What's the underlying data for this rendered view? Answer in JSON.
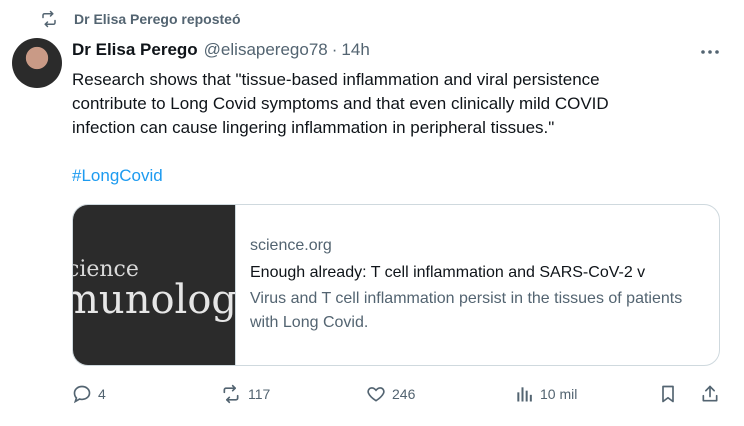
{
  "repost": {
    "label": "Dr Elisa Perego reposteó",
    "icon": "repost-icon"
  },
  "tweet": {
    "author_name": "Dr Elisa Perego",
    "handle": "@elisaperego78",
    "separator": "·",
    "time": "14h",
    "more_icon": "more-icon",
    "text_line1": "Research shows that \"tissue-based inflammation and viral persistence",
    "text_line2": "contribute to Long Covid symptoms and that even clinically mild COVID",
    "text_line3": "infection can cause lingering inflammation in peripheral tissues.\"",
    "hashtag": "#LongCovid"
  },
  "card": {
    "thumb_line1": "cience",
    "thumb_line2": "munolog",
    "domain": "science.org",
    "title": "Enough already: T cell inflammation and SARS-CoV-2 v",
    "description": "Virus and T cell inflammation persist in the tissues of patients with Long Covid."
  },
  "actions": {
    "reply_count": "4",
    "repost_count": "117",
    "like_count": "246",
    "views_count": "10 mil"
  },
  "colors": {
    "text": "#0f1419",
    "secondary": "#536471",
    "accent": "#1d9bf0",
    "border": "#cfd9de"
  }
}
